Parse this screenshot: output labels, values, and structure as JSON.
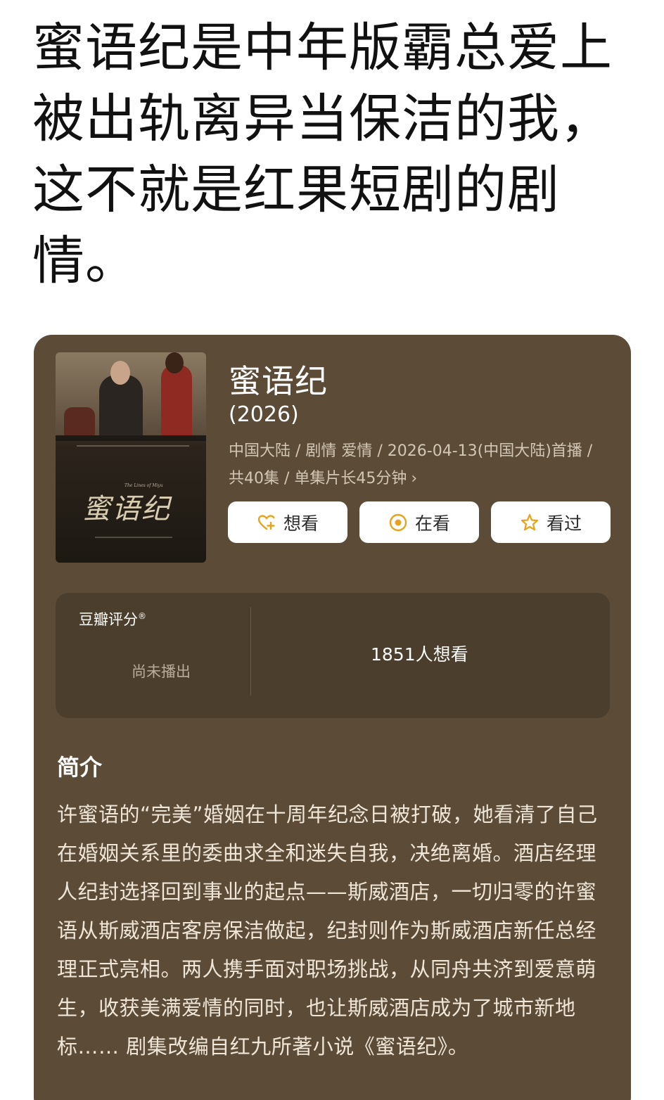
{
  "post": {
    "headline": "蜜语纪是中年版霸总爱上被出轨离异当保洁的我，这不就是红果短剧的剧情。"
  },
  "card": {
    "poster": {
      "logo_text": "蜜语纪",
      "subtitle_text": "The Lines of Miyu"
    },
    "title": "蜜语纪",
    "year": "(2026)",
    "meta_line1": "中国大陆 / 剧情 爱情 / 2026-04-13(中国大陆)首播 /",
    "meta_line2": "共40集 / 单集片长45分钟",
    "meta_chevron": "›",
    "buttons": {
      "want": "想看",
      "watching": "在看",
      "watched": "看过"
    },
    "rating": {
      "label": "豆瓣评分",
      "registered": "®",
      "status": "尚未播出",
      "want_count": "1851人想看"
    },
    "intro": {
      "heading": "简介",
      "text": "许蜜语的“完美”婚姻在十周年纪念日被打破，她看清了自己在婚姻关系里的委曲求全和迷失自我，决绝离婚。酒店经理人纪封选择回到事业的起点——斯威酒店，一切归零的许蜜语从斯威酒店客房保洁做起，纪封则作为斯威酒店新任总经理正式亮相。两人携手面对职场挑战，从同舟共济到爱意萌生，收获美满爱情的同时，也让斯威酒店成为了城市新地标…… 剧集改编自红九所著小说《蜜语纪》。"
    }
  },
  "colors": {
    "card_bg": "#5b4b37",
    "rating_bg": "#4c3e2d",
    "accent_orange": "#e8a31c"
  },
  "icons": {
    "want": "heart-plus-icon",
    "watching": "target-icon",
    "watched": "star-icon",
    "meta_more": "chevron-right-icon"
  }
}
